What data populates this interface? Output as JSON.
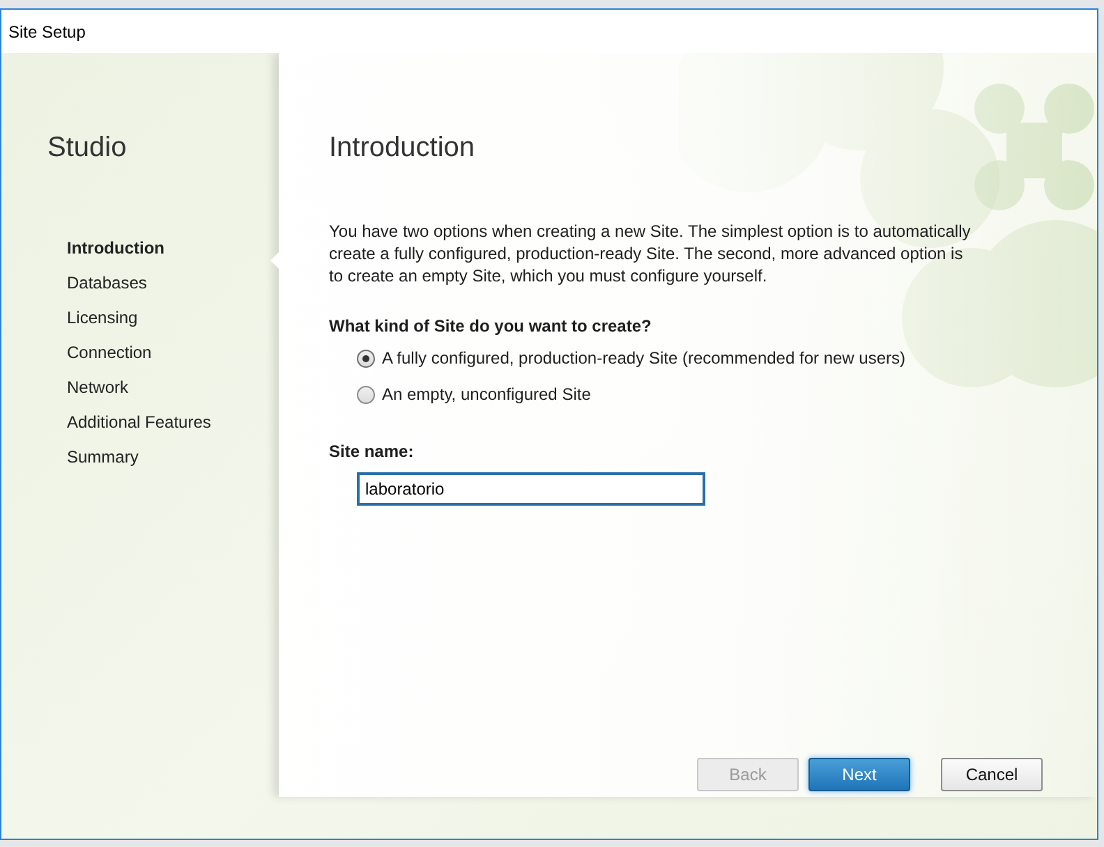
{
  "window": {
    "title": "Site Setup"
  },
  "sidebar": {
    "title": "Studio",
    "items": [
      {
        "label": "Introduction",
        "selected": true
      },
      {
        "label": "Databases",
        "selected": false
      },
      {
        "label": "Licensing",
        "selected": false
      },
      {
        "label": "Connection",
        "selected": false
      },
      {
        "label": "Network",
        "selected": false
      },
      {
        "label": "Additional Features",
        "selected": false
      },
      {
        "label": "Summary",
        "selected": false
      }
    ]
  },
  "page": {
    "heading": "Introduction",
    "description": "You have two options when creating a new Site. The simplest option is to automatically create a fully configured, production-ready Site. The second, more advanced option is to create an empty Site, which you must configure yourself.",
    "question": "What kind of Site do you want to create?",
    "options": [
      {
        "label": "A fully configured, production-ready Site (recommended for new users)",
        "selected": true
      },
      {
        "label": "An empty, unconfigured Site",
        "selected": false
      }
    ],
    "site_name": {
      "label": "Site name:",
      "value": "laboratorio"
    }
  },
  "buttons": [
    {
      "label": "Back",
      "disabled": true,
      "primary": false
    },
    {
      "label": "Next",
      "disabled": false,
      "primary": true
    },
    {
      "label": "Cancel",
      "disabled": false,
      "primary": false
    }
  ]
}
